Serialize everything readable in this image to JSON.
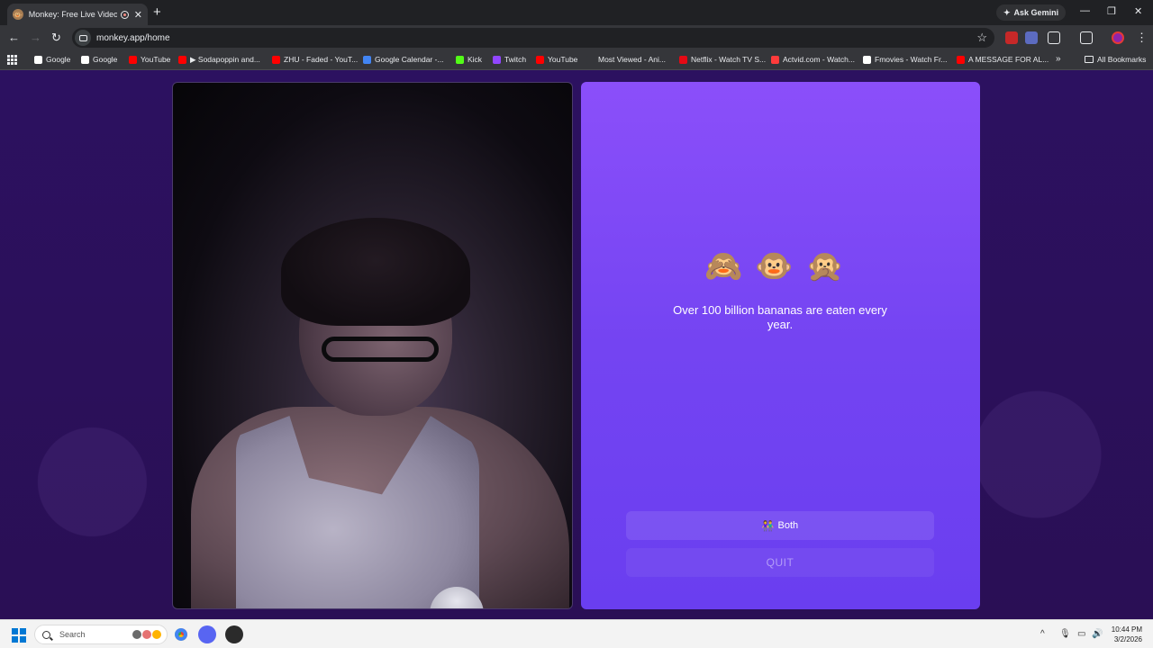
{
  "browser": {
    "tab_title": "Monkey: Free Live Video Ch",
    "new_tab_glyph": "+",
    "ask_gemini": "Ask Gemini",
    "url": "monkey.app/home",
    "window_controls": {
      "minimize": "—",
      "restore": "❐",
      "close": "✕"
    }
  },
  "bookmarks": [
    {
      "label": "Google",
      "icon_color": "#ffffff"
    },
    {
      "label": "Google",
      "icon_color": "#ffffff"
    },
    {
      "label": "YouTube",
      "icon_color": "#ff0000"
    },
    {
      "label": "▶ Sodapoppin and...",
      "icon_color": "#ff0000"
    },
    {
      "label": "ZHU - Faded - YouT...",
      "icon_color": "#ff0000"
    },
    {
      "label": "Google Calendar -...",
      "icon_color": "#4285f4"
    },
    {
      "label": "Kick",
      "icon_color": "#53fc18"
    },
    {
      "label": "Twitch",
      "icon_color": "#9146ff"
    },
    {
      "label": "YouTube",
      "icon_color": "#ff0000"
    },
    {
      "label": "Most Viewed - Ani...",
      "icon_color": "#35363a"
    },
    {
      "label": "Netflix - Watch TV S...",
      "icon_color": "#e50914"
    },
    {
      "label": "Actvid.com - Watch...",
      "icon_color": "#ff3b3b"
    },
    {
      "label": "Fmovies - Watch Fr...",
      "icon_color": "#ffffff"
    },
    {
      "label": "A MESSAGE FOR AL...",
      "icon_color": "#ff0000"
    }
  ],
  "bookmarks_more": "»",
  "all_bookmarks": "All Bookmarks",
  "main": {
    "monkeys": "🙈🐵🙊",
    "fact": "Over 100 billion bananas are eaten every year.",
    "both_emoji": "👫",
    "both_label": "Both",
    "quit_label": "QUIT"
  },
  "taskbar": {
    "search_placeholder": "Search",
    "clock_time": "10:44 PM",
    "clock_date": "3/2/2026"
  },
  "colors": {
    "page_bg": "#2a1158",
    "panel_accent": "#7a46f4"
  }
}
